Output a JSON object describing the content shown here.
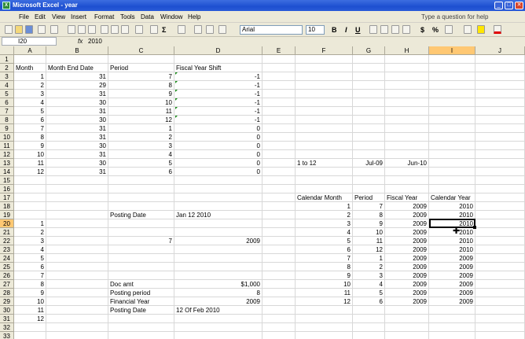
{
  "window": {
    "title": "Microsoft Excel - year",
    "controls": [
      "_",
      "□",
      "✕"
    ]
  },
  "menu": [
    "File",
    "Edit",
    "View",
    "Insert",
    "Format",
    "Tools",
    "Data",
    "Window",
    "Help"
  ],
  "help_placeholder": "Type a question for help",
  "toolbar": {
    "font": "Arial",
    "size": "10",
    "bold": "B",
    "italic": "I",
    "underline": "U",
    "currency": "$",
    "percent": "%"
  },
  "formula_bar": {
    "name_box": "I20",
    "fx": "fx",
    "value": "2010"
  },
  "columns": [
    "A",
    "B",
    "C",
    "D",
    "E",
    "F",
    "G",
    "H",
    "I",
    "J"
  ],
  "rows": [
    "1",
    "2",
    "3",
    "4",
    "5",
    "6",
    "7",
    "8",
    "9",
    "10",
    "11",
    "12",
    "13",
    "14",
    "15",
    "16",
    "17",
    "18",
    "19",
    "20",
    "21",
    "22",
    "23",
    "24",
    "25",
    "26",
    "27",
    "28",
    "29",
    "30",
    "31",
    "32",
    "33"
  ],
  "cells": {
    "A2": "Month",
    "B2": "Month End Date",
    "C2": "Period",
    "D2": "Fiscal Year Shift",
    "A3": "1",
    "B3": "31",
    "C3": "7",
    "D3": "-1",
    "A4": "2",
    "B4": "29",
    "C4": "8",
    "D4": "-1",
    "A5": "3",
    "B5": "31",
    "C5": "9",
    "D5": "-1",
    "A6": "4",
    "B6": "30",
    "C6": "10",
    "D6": "-1",
    "A7": "5",
    "B7": "31",
    "C7": "11",
    "D7": "-1",
    "A8": "6",
    "B8": "30",
    "C8": "12",
    "D8": "-1",
    "A9": "7",
    "B9": "31",
    "C9": "1",
    "D9": "0",
    "A10": "8",
    "B10": "31",
    "C10": "2",
    "D10": "0",
    "A11": "9",
    "B11": "30",
    "C11": "3",
    "D11": "0",
    "A12": "10",
    "B12": "31",
    "C12": "4",
    "D12": "0",
    "A13": "11",
    "B13": "30",
    "C13": "5",
    "D13": "0",
    "F13": "1 to 12",
    "G13": "Jul-09",
    "H13": "Jun-10",
    "A14": "12",
    "B14": "31",
    "C14": "6",
    "D14": "0",
    "F17": "Calendar Month",
    "G17": "Period",
    "H17": "Fiscal Year",
    "I17": "Calendar Year",
    "F18": "1",
    "G18": "7",
    "H18": "2009",
    "I18": "2010",
    "C19": "Posting Date",
    "D19": "Jan 12 2010",
    "F19": "2",
    "G19": "8",
    "H19": "2009",
    "I19": "2010",
    "A20": "1",
    "F20": "3",
    "G20": "9",
    "H20": "2009",
    "I20": "2010",
    "A21": "2",
    "F21": "4",
    "G21": "10",
    "H21": "2009",
    "I21": "2010",
    "A22": "3",
    "C22": "7",
    "D22": "2009",
    "F22": "5",
    "G22": "11",
    "H22": "2009",
    "I22": "2010",
    "A23": "4",
    "F23": "6",
    "G23": "12",
    "H23": "2009",
    "I23": "2010",
    "A24": "5",
    "F24": "7",
    "G24": "1",
    "H24": "2009",
    "I24": "2009",
    "A25": "6",
    "F25": "8",
    "G25": "2",
    "H25": "2009",
    "I25": "2009",
    "A26": "7",
    "F26": "9",
    "G26": "3",
    "H26": "2009",
    "I26": "2009",
    "A27": "8",
    "C27": "Doc amt",
    "D27": "$1,000",
    "F27": "10",
    "G27": "4",
    "H27": "2009",
    "I27": "2009",
    "A28": "9",
    "C28": "Posting period",
    "D28": "8",
    "F28": "11",
    "G28": "5",
    "H28": "2009",
    "I28": "2009",
    "A29": "10",
    "C29": "Financial Year",
    "D29": "2009",
    "F29": "12",
    "G29": "6",
    "H29": "2009",
    "I29": "2009",
    "A30": "11",
    "C30": "Posting Date",
    "D30": "12 Of Feb 2010",
    "A31": "12"
  },
  "selected_cell": "I20"
}
